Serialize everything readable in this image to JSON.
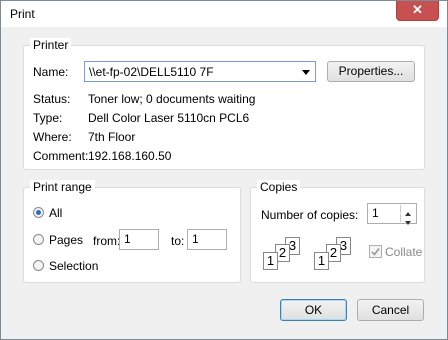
{
  "window": {
    "title": "Print",
    "close_glyph": "✕"
  },
  "printer": {
    "legend": "Printer",
    "name_label": "Name:",
    "name_value": "\\\\et-fp-02\\DELL5110 7F",
    "properties_label": "Properties...",
    "status_label": "Status:",
    "status_value": "Toner low; 0 documents waiting",
    "type_label": "Type:",
    "type_value": "Dell Color Laser 5110cn PCL6",
    "where_label": "Where:",
    "where_value": "7th Floor",
    "comment_label": "Comment:",
    "comment_value": "192.168.160.50"
  },
  "print_range": {
    "legend": "Print range",
    "all_label": "All",
    "pages_label": "Pages",
    "from_label": "from:",
    "from_value": "1",
    "to_label": "to:",
    "to_value": "1",
    "selection_label": "Selection",
    "selected": "all"
  },
  "copies": {
    "legend": "Copies",
    "number_label": "Number of copies:",
    "number_value": "1",
    "collate_label": "Collate",
    "collate_checked": true,
    "page_digits": [
      "1",
      "2",
      "3"
    ]
  },
  "footer": {
    "ok_label": "OK",
    "cancel_label": "Cancel"
  },
  "icons": [
    "close-icon",
    "dropdown-arrow-icon",
    "spin-up-icon",
    "spin-down-icon",
    "checkmark-icon"
  ]
}
